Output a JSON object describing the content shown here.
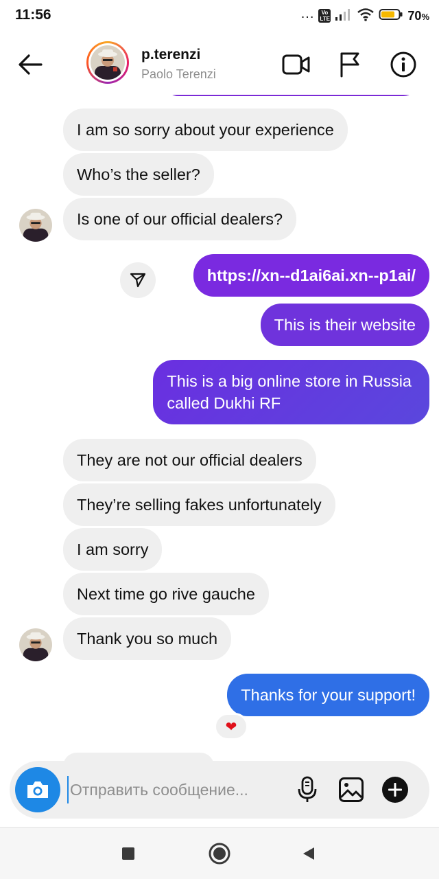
{
  "status": {
    "time": "11:56",
    "dots": "...",
    "network_badge": "Vo LTE",
    "battery": "70",
    "battery_unit": "%"
  },
  "header": {
    "username": "p.terenzi",
    "full_name": "Paolo Terenzi",
    "icons": [
      "back-arrow-icon",
      "video-call-icon",
      "flag-icon",
      "info-icon"
    ]
  },
  "messages": [
    {
      "from": "them",
      "text": "I am so sorry about your experience"
    },
    {
      "from": "them",
      "text": "Who’s the seller?"
    },
    {
      "from": "them",
      "text": "Is one of our official dealers?"
    },
    {
      "from": "me",
      "text": "https://xn--d1ai6ai.xn--p1ai/"
    },
    {
      "from": "me",
      "text": "This is their website"
    },
    {
      "from": "me",
      "text_line1": "This is a big online store in Russia",
      "text_line2": "called Dukhi RF"
    },
    {
      "from": "them",
      "text": "They are not our official dealers"
    },
    {
      "from": "them",
      "text": "They’re selling fakes unfortunately"
    },
    {
      "from": "them",
      "text": "I am sorry"
    },
    {
      "from": "them",
      "text": "Next time go rive gauche"
    },
    {
      "from": "them",
      "text": "Thank you so much"
    },
    {
      "from": "me",
      "text": "Thanks for your support!",
      "reaction": "❤"
    }
  ],
  "composer": {
    "placeholder": "Отправить сообщение...",
    "icons": [
      "camera-icon",
      "microphone-icon",
      "gallery-icon",
      "plus-icon"
    ]
  },
  "colors": {
    "outgoing_purple": "#7a2ae0",
    "outgoing_blue": "#2f6fe6",
    "incoming_gray": "#efefef",
    "camera_blue": "#1e88e5"
  }
}
